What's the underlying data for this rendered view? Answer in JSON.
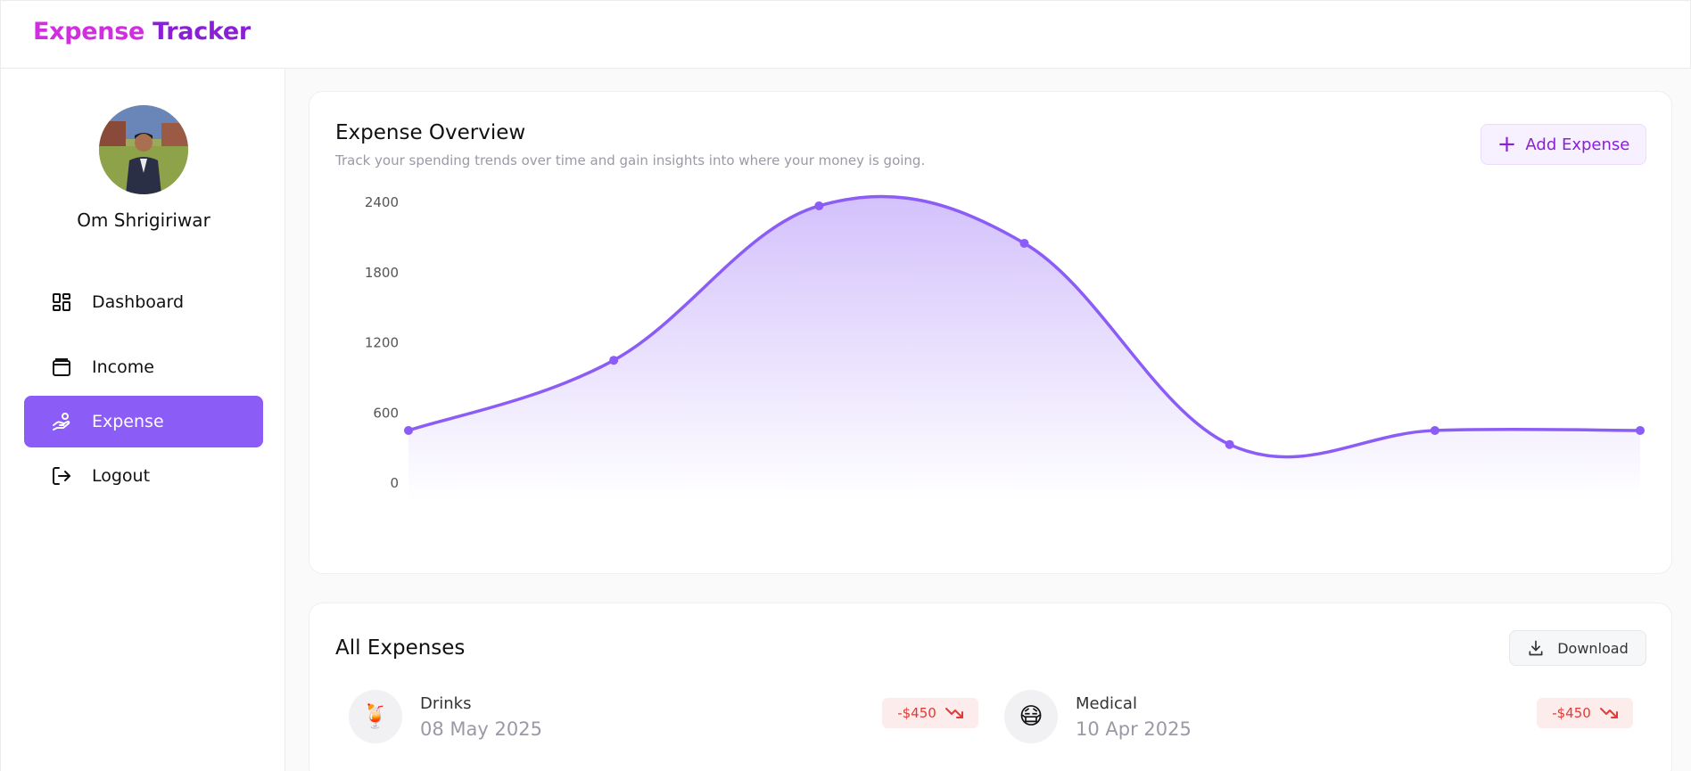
{
  "brand": {
    "part1": "Expense",
    "part2": "Tracker",
    "color1": "#d12ee0",
    "color2": "#8a1fd6"
  },
  "user": {
    "name": "Om Shrigiriwar"
  },
  "nav": [
    {
      "label": "Dashboard",
      "icon": "dashboard-icon",
      "active": false
    },
    {
      "label": "Income",
      "icon": "wallet-icon",
      "active": false
    },
    {
      "label": "Expense",
      "icon": "hand-coins-icon",
      "active": true
    },
    {
      "label": "Logout",
      "icon": "logout-icon",
      "active": false
    }
  ],
  "overview": {
    "title": "Expense Overview",
    "subtitle": "Track your spending trends over time and gain insights into where your money is going.",
    "add_label": "Add Expense"
  },
  "chart_data": {
    "type": "area",
    "ylim": [
      0,
      2400
    ],
    "yticks": [
      0,
      600,
      1200,
      1800,
      2400
    ],
    "values": [
      450,
      1050,
      2370,
      2050,
      330,
      450,
      450
    ],
    "grid": false,
    "color": "#8b5cf6"
  },
  "expenses": {
    "title": "All Expenses",
    "download_label": "Download",
    "items": [
      {
        "name": "Drinks",
        "date": "08 May 2025",
        "amount": "-$450",
        "emoji": "🍹"
      },
      {
        "name": "Medical",
        "date": "10 Apr 2025",
        "amount": "-$450",
        "emoji": "😷"
      }
    ]
  }
}
